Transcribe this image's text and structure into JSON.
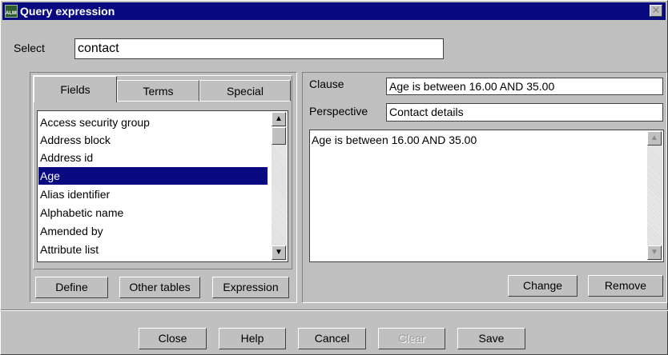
{
  "window": {
    "title": "Query expression",
    "app_icon_text": "ALMS",
    "close_glyph": "✕"
  },
  "select": {
    "label": "Select",
    "value": "contact"
  },
  "tabs": [
    {
      "label": "Fields",
      "active": true
    },
    {
      "label": "Terms",
      "active": false
    },
    {
      "label": "Special",
      "active": false
    }
  ],
  "fields_list": {
    "items": [
      "Access security group",
      "Address block",
      "Address id",
      "Age",
      "Alias identifier",
      "Alphabetic name",
      "Amended by",
      "Attribute list"
    ],
    "selected": "Age"
  },
  "left_buttons": {
    "define": "Define",
    "other_tables": "Other tables",
    "expression": "Expression"
  },
  "clause": {
    "label": "Clause",
    "value": "Age is between 16.00 AND 35.00"
  },
  "perspective": {
    "label": "Perspective",
    "value": "Contact details"
  },
  "expression_text": "Age is between 16.00 AND 35.00",
  "right_buttons": {
    "change": "Change",
    "remove": "Remove"
  },
  "bottom_buttons": {
    "close": "Close",
    "help": "Help",
    "cancel": "Cancel",
    "clear": "Clear",
    "save": "Save"
  },
  "icons": {
    "scroll_up": "▲",
    "scroll_down": "▼"
  },
  "colors": {
    "titlebar": "#0a0a80",
    "selection": "#0a0a80",
    "face": "#c0c0c0"
  }
}
